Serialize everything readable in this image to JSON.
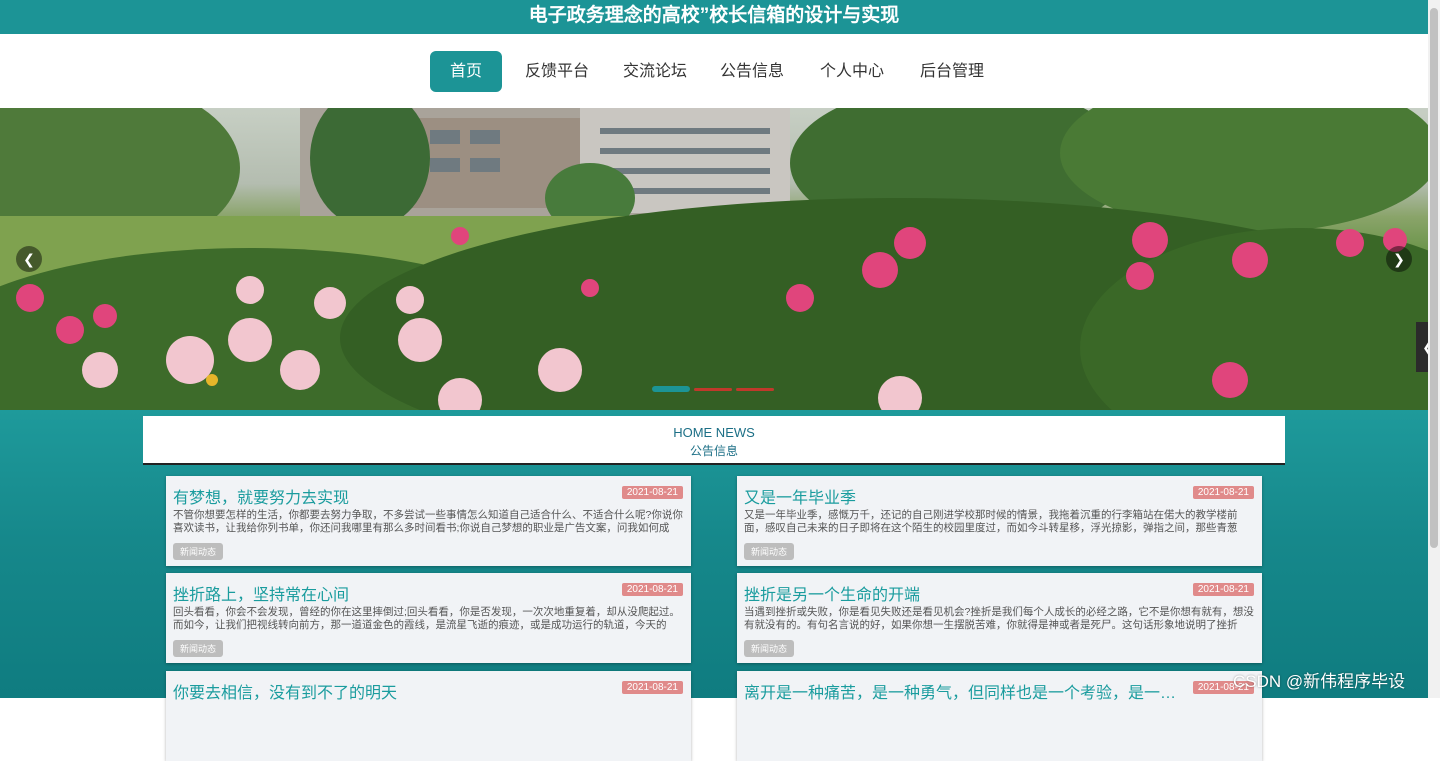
{
  "site": {
    "title": "电子政务理念的高校”校长信箱的设计与实现"
  },
  "nav": {
    "items": [
      {
        "label": "首页",
        "active": true
      },
      {
        "label": "反馈平台"
      },
      {
        "label": "交流论坛"
      },
      {
        "label": "公告信息"
      },
      {
        "label": "个人中心"
      },
      {
        "label": "后台管理"
      }
    ]
  },
  "banner": {
    "prev_icon": "chevron-left-icon",
    "next_icon": "chevron-right-icon",
    "active_slide": 1,
    "slide_count": 3,
    "colors": {
      "active_dot": "#1c9496",
      "dot": "#c0392b"
    }
  },
  "side_tab": {
    "icon": "chevron-left-icon"
  },
  "news": {
    "header_en": "HOME NEWS",
    "header_cn": "公告信息",
    "items": [
      {
        "title": "有梦想，就要努力去实现",
        "date": "2021-08-21",
        "excerpt": "不管你想要怎样的生活，你都要去努力争取，不多尝试一些事情怎么知道自己适合什么、不适合什么呢?你说你喜欢读书，让我给你列书单，你还问我哪里有那么多时间看书;你说自己梦想的职业是广告文案，问我如何成",
        "tag": "新闻动态"
      },
      {
        "title": "又是一年毕业季",
        "date": "2021-08-21",
        "excerpt": "又是一年毕业季，感慨万千，还记的自己刚进学校那时候的情景，我拖着沉重的行李箱站在偌大的教学楼前面，感叹自己未来的日子即将在这个陌生的校园里度过，而如今斗转星移，浮光掠影，弹指之间，那些青葱",
        "tag": "新闻动态"
      },
      {
        "title": "挫折路上，坚持常在心间",
        "date": "2021-08-21",
        "excerpt": "回头看看，你会不会发现，曾经的你在这里摔倒过;回头看看，你是否发现，一次次地重复着，却从没爬起过。而如今，让我们把视线转向前方，那一道道金色的霞线，是流星飞逝的痕迹，或是成功运行的轨道，今天的",
        "tag": "新闻动态"
      },
      {
        "title": "挫折是另一个生命的开端",
        "date": "2021-08-21",
        "excerpt": "当遇到挫折或失败，你是看见失败还是看见机会?挫折是我们每个人成长的必经之路，它不是你想有就有，想没有就没有的。有句名言说的好，如果你想一生摆脱苦难，你就得是神或者是死尸。这句话形象地说明了挫折",
        "tag": "新闻动态"
      },
      {
        "title": "你要去相信，没有到不了的明天",
        "date": "2021-08-21",
        "excerpt": "",
        "tag": ""
      },
      {
        "title": "离开是一种痛苦，是一种勇气，但同样也是一个考验，是一个新的...",
        "date": "2021-08-21",
        "excerpt": "",
        "tag": ""
      }
    ]
  },
  "watermark": "CSDN @新伟程序毕设"
}
